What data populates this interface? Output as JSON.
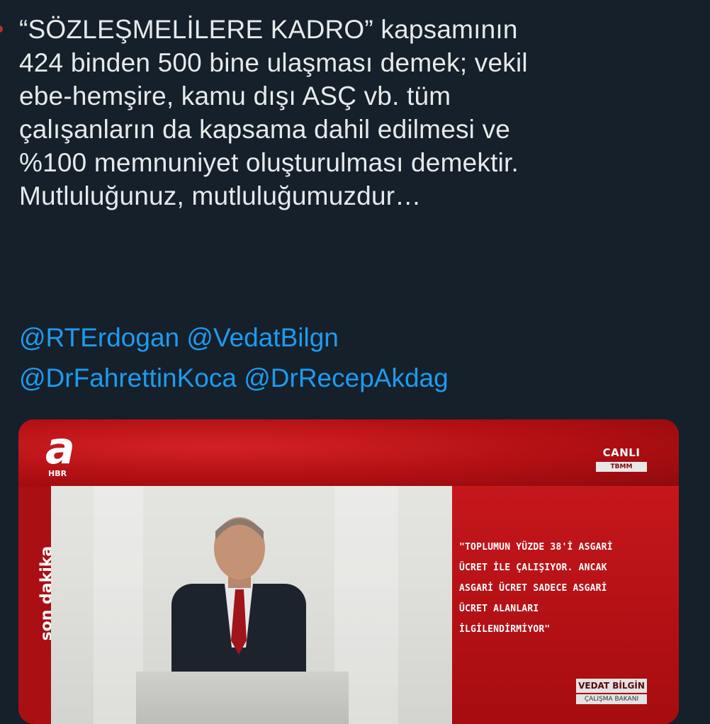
{
  "tweet": {
    "text_lines": [
      "“SÖZLEŞMELİLERE KADRO” kapsamının",
      "424 binden 500 bine ulaşması demek; vekil",
      "ebe-hemşire, kamu dışı ASÇ vb. tüm",
      "çalışanların da kapsama dahil edilmesi ve",
      "%100 memnuniyet oluşturulması demektir.",
      "Mutluluğunuz, mutluluğumuzdur…"
    ],
    "mentions": [
      "@RTErdogan",
      "@VedatBilgn",
      "@DrFahrettinKoca",
      "@DrRecepAkdag"
    ]
  },
  "media": {
    "channel_logo_letter": "a",
    "channel_logo_sub": "HBR",
    "live_label": "CANLI",
    "live_sub": "TBMM",
    "side_banner": "son dakika",
    "quote_lines": [
      "\"TOPLUMUN YÜZDE 38'İ ASGARİ",
      "ÜCRET İLE ÇALIŞIYOR. ANCAK",
      "ASGARİ ÜCRET SADECE ASGARİ",
      "ÜCRET ALANLARI",
      "İLGİLENDİRMİYOR\""
    ],
    "speaker_name": "VEDAT BİLGİN",
    "speaker_title": "ÇALIŞMA BAKANI"
  },
  "colors": {
    "background": "#15202b",
    "text": "#e7e9ea",
    "link": "#1d9bf0",
    "broadcast_red": "#b50d12"
  }
}
